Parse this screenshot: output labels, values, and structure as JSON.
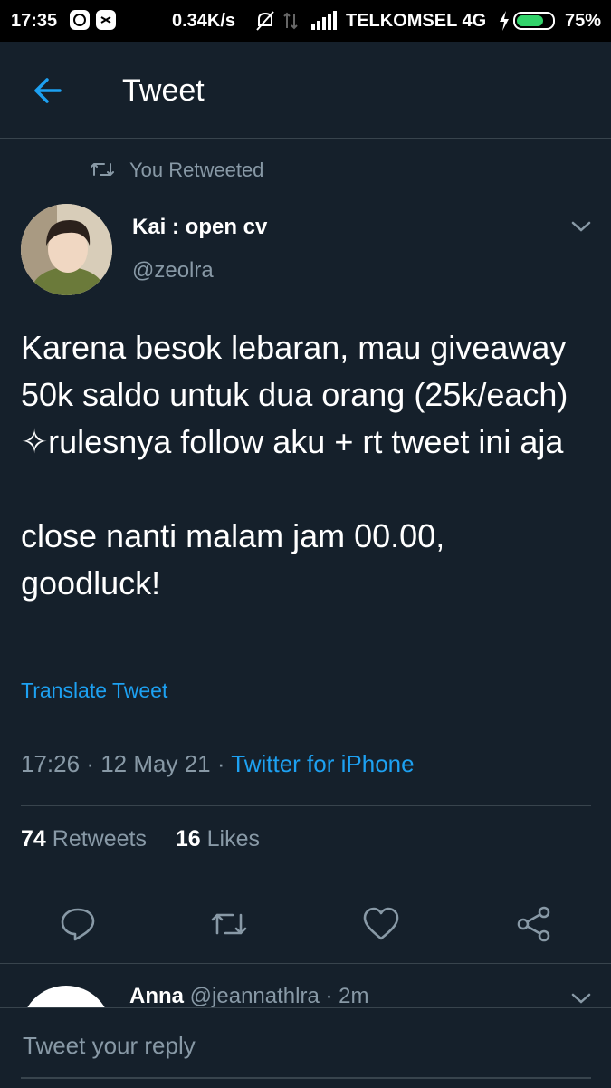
{
  "status_bar": {
    "time": "17:35",
    "speed": "0.34K/s",
    "carrier": "TELKOMSEL 4G",
    "battery": "75%",
    "battery_level": 0.75
  },
  "header": {
    "title": "Tweet"
  },
  "retweet_context": {
    "label": "You Retweeted"
  },
  "tweet": {
    "author_name": "Kai : open cv",
    "author_handle": "@zeolra",
    "text": "Karena besok lebaran, mau giveaway 50k saldo untuk dua orang (25k/each) ✧rulesnya follow aku + rt tweet ini aja\n\nclose nanti malam jam 00.00, goodluck!",
    "translate_label": "Translate Tweet",
    "time": "17:26",
    "date": "12 May 21",
    "source": "Twitter for iPhone",
    "retweet_count": "74",
    "retweet_label": "Retweets",
    "like_count": "16",
    "like_label": "Likes"
  },
  "actions": [
    "reply-icon",
    "retweet-icon",
    "like-icon",
    "share-icon"
  ],
  "reply_preview": {
    "name": "Anna",
    "handle": "@jeannathlra",
    "time": "2m"
  },
  "composer": {
    "placeholder": "Tweet your reply"
  },
  "colors": {
    "background": "#15202b",
    "accent": "#1da1f2",
    "secondary_text": "#8899a6",
    "divider": "#38444d"
  }
}
